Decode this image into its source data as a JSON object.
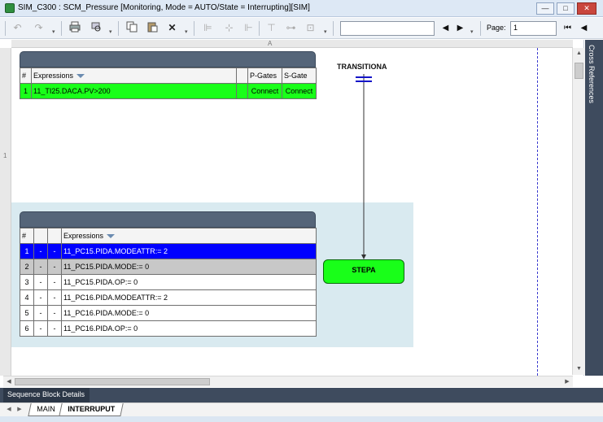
{
  "window": {
    "title": "SIM_C300 : SCM_Pressure [Monitoring, Mode  = AUTO/State = Interrupting][SIM]",
    "min_glyph": "—",
    "max_glyph": "□",
    "close_glyph": "✕"
  },
  "toolbar": {
    "page_label": "Page:",
    "page_value": "1",
    "search_value": ""
  },
  "canvas": {
    "ruler_column": "A",
    "ruler_row": "1"
  },
  "transition_grid": {
    "headers": [
      "#",
      "Expressions",
      "",
      "P-Gates",
      "S-Gate"
    ],
    "rows": [
      {
        "num": "1",
        "expression": "11_TI25.DACA.PV>200",
        "blank": "",
        "p_gates": "Connect",
        "s_gate": "Connect",
        "color": "#19ff19"
      }
    ]
  },
  "step_grid": {
    "headers": [
      "#",
      "",
      "",
      "Expressions"
    ],
    "rows": [
      {
        "num": "1",
        "c1": "-",
        "c2": "-",
        "expression": "11_PC15.PIDA.MODEATTR:= 2",
        "state": "selected"
      },
      {
        "num": "2",
        "c1": "-",
        "c2": "-",
        "expression": "11_PC15.PIDA.MODE:= 0",
        "state": "gray"
      },
      {
        "num": "3",
        "c1": "-",
        "c2": "-",
        "expression": "11_PC15.PIDA.OP:= 0",
        "state": "normal"
      },
      {
        "num": "4",
        "c1": "-",
        "c2": "-",
        "expression": "11_PC16.PIDA.MODEATTR:= 2",
        "state": "normal"
      },
      {
        "num": "5",
        "c1": "-",
        "c2": "-",
        "expression": "11_PC16.PIDA.MODE:= 0",
        "state": "normal"
      },
      {
        "num": "6",
        "c1": "-",
        "c2": "-",
        "expression": "11_PC16.PIDA.OP:= 0",
        "state": "normal"
      }
    ]
  },
  "sfc": {
    "transition_name": "TRANSITIONA",
    "step_name": "STEPA",
    "active_color": "#19ff19"
  },
  "side_panel": {
    "label": "Cross References"
  },
  "bottom": {
    "details_label": "Sequence Block Details",
    "tabs": [
      {
        "label": "MAIN",
        "active": false
      },
      {
        "label": "INTERRUPUT",
        "active": true
      }
    ]
  },
  "icons": [
    "undo-icon",
    "redo-icon",
    "print-icon",
    "print-preview-icon",
    "copy-icon",
    "paste-icon",
    "delete-icon",
    "align-left-icon",
    "align-center-icon",
    "align-top-icon",
    "align-middle-icon",
    "distribute-icon",
    "prev-icon",
    "next-icon",
    "first-page-icon",
    "prev-page-icon"
  ]
}
